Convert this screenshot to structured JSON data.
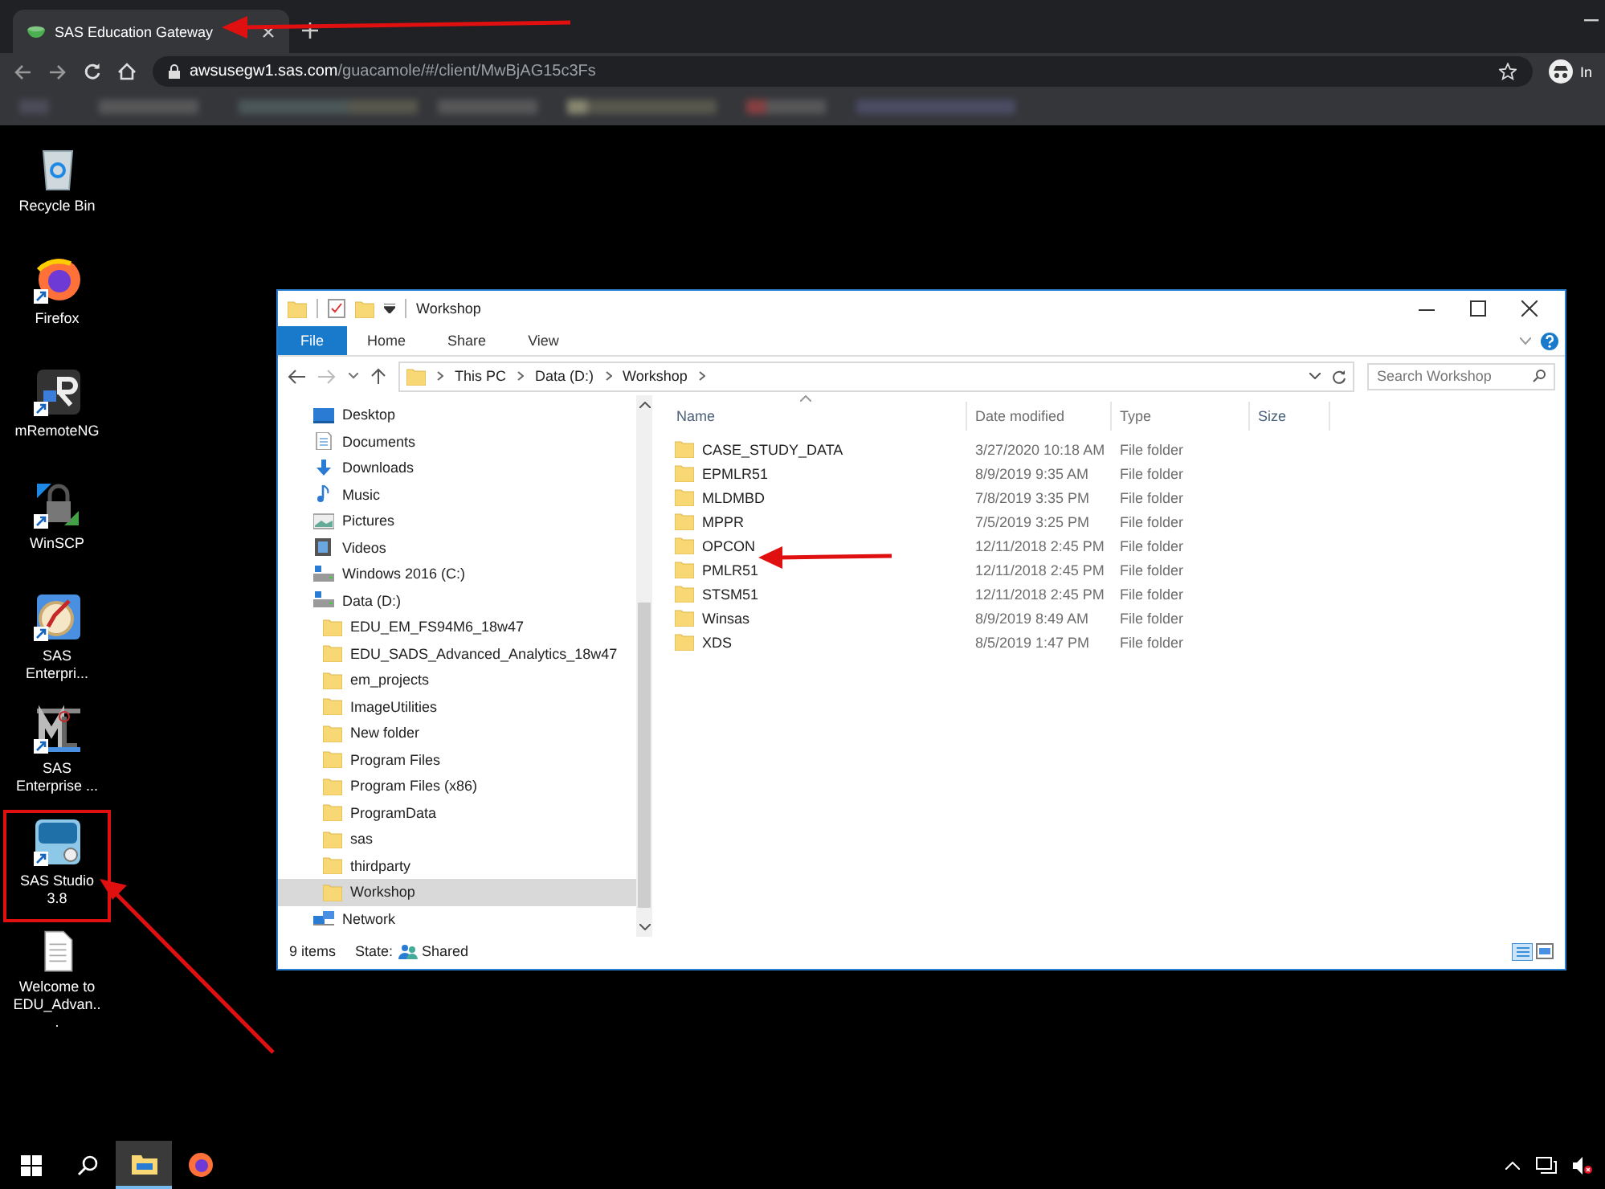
{
  "browser": {
    "tab": {
      "title": "SAS Education Gateway",
      "selected": true
    },
    "url": {
      "host": "awsusegw1.sas.com",
      "path": "/guacamole/#/client/MwBjAG15c3Fs"
    },
    "profile_label": "In"
  },
  "desktop_icons": [
    {
      "kind": "recycle",
      "label": "Recycle Bin",
      "highlighted": false
    },
    {
      "kind": "firefox",
      "label": "Firefox",
      "highlighted": false
    },
    {
      "kind": "mremote",
      "label": "mRemoteNG",
      "highlighted": false
    },
    {
      "kind": "winscp",
      "label": "WinSCP",
      "highlighted": false
    },
    {
      "kind": "compass",
      "label": "SAS Enterpri...",
      "highlighted": false
    },
    {
      "kind": "miner",
      "label": "SAS Enterprise ...",
      "highlighted": false
    },
    {
      "kind": "sas",
      "label": "SAS Studio 3.8",
      "highlighted": true
    },
    {
      "kind": "document",
      "label": "Welcome to EDU_Advan...",
      "highlighted": false
    }
  ],
  "explorer": {
    "title": "Workshop",
    "ribbon_tabs": [
      {
        "label": "File",
        "kind": "file",
        "selected": false
      },
      {
        "label": "Home",
        "kind": "tab",
        "selected": false
      },
      {
        "label": "Share",
        "kind": "tab",
        "selected": false
      },
      {
        "label": "View",
        "kind": "tab",
        "selected": false
      }
    ],
    "breadcrumb": [
      "This PC",
      "Data (D:)",
      "Workshop"
    ],
    "search": {
      "placeholder": "Search Workshop"
    },
    "nav": [
      {
        "kind": "desktop",
        "label": "Desktop",
        "selected": false
      },
      {
        "kind": "documents",
        "label": "Documents",
        "selected": false
      },
      {
        "kind": "downloads",
        "label": "Downloads",
        "selected": false
      },
      {
        "kind": "music",
        "label": "Music",
        "selected": false
      },
      {
        "kind": "pictures",
        "label": "Pictures",
        "selected": false
      },
      {
        "kind": "videos",
        "label": "Videos",
        "selected": false
      },
      {
        "kind": "drive",
        "label": "Windows 2016 (C:)",
        "selected": false
      },
      {
        "kind": "drive",
        "label": "Data (D:)",
        "selected": false,
        "children": [
          {
            "kind": "folder",
            "label": "EDU_EM_FS94M6_18w47",
            "selected": false
          },
          {
            "kind": "folder",
            "label": "EDU_SADS_Advanced_Analytics_18w47",
            "selected": false
          },
          {
            "kind": "folder",
            "label": "em_projects",
            "selected": false
          },
          {
            "kind": "folder",
            "label": "ImageUtilities",
            "selected": false
          },
          {
            "kind": "folder",
            "label": "New folder",
            "selected": false
          },
          {
            "kind": "folder",
            "label": "Program Files",
            "selected": false
          },
          {
            "kind": "folder",
            "label": "Program Files (x86)",
            "selected": false
          },
          {
            "kind": "folder",
            "label": "ProgramData",
            "selected": false
          },
          {
            "kind": "folder",
            "label": "sas",
            "selected": false
          },
          {
            "kind": "folder",
            "label": "thirdparty",
            "selected": false
          },
          {
            "kind": "folder",
            "label": "Workshop",
            "selected": true
          }
        ]
      },
      {
        "kind": "network",
        "label": "Network",
        "selected": false
      }
    ],
    "columns": [
      "Name",
      "Date modified",
      "Type",
      "Size"
    ],
    "rows": [
      {
        "name": "CASE_STUDY_DATA",
        "date": "3/27/2020 10:18 AM",
        "type": "File folder"
      },
      {
        "name": "EPMLR51",
        "date": "8/9/2019 9:35 AM",
        "type": "File folder"
      },
      {
        "name": "MLDMBD",
        "date": "7/8/2019 3:35 PM",
        "type": "File folder"
      },
      {
        "name": "MPPR",
        "date": "7/5/2019 3:25 PM",
        "type": "File folder"
      },
      {
        "name": "OPCON",
        "date": "12/11/2018 2:45 PM",
        "type": "File folder"
      },
      {
        "name": "PMLR51",
        "date": "12/11/2018 2:45 PM",
        "type": "File folder"
      },
      {
        "name": "STSM51",
        "date": "12/11/2018 2:45 PM",
        "type": "File folder"
      },
      {
        "name": "Winsas",
        "date": "8/9/2019 8:49 AM",
        "type": "File folder"
      },
      {
        "name": "XDS",
        "date": "8/5/2019 1:47 PM",
        "type": "File folder"
      }
    ],
    "status": {
      "count": "9 items",
      "state_label": "State:",
      "state_value": "Shared"
    }
  },
  "taskbar": [
    {
      "kind": "start",
      "active": false
    },
    {
      "kind": "search",
      "active": false
    },
    {
      "kind": "explorer",
      "active": true
    },
    {
      "kind": "firefox",
      "active": false
    }
  ]
}
